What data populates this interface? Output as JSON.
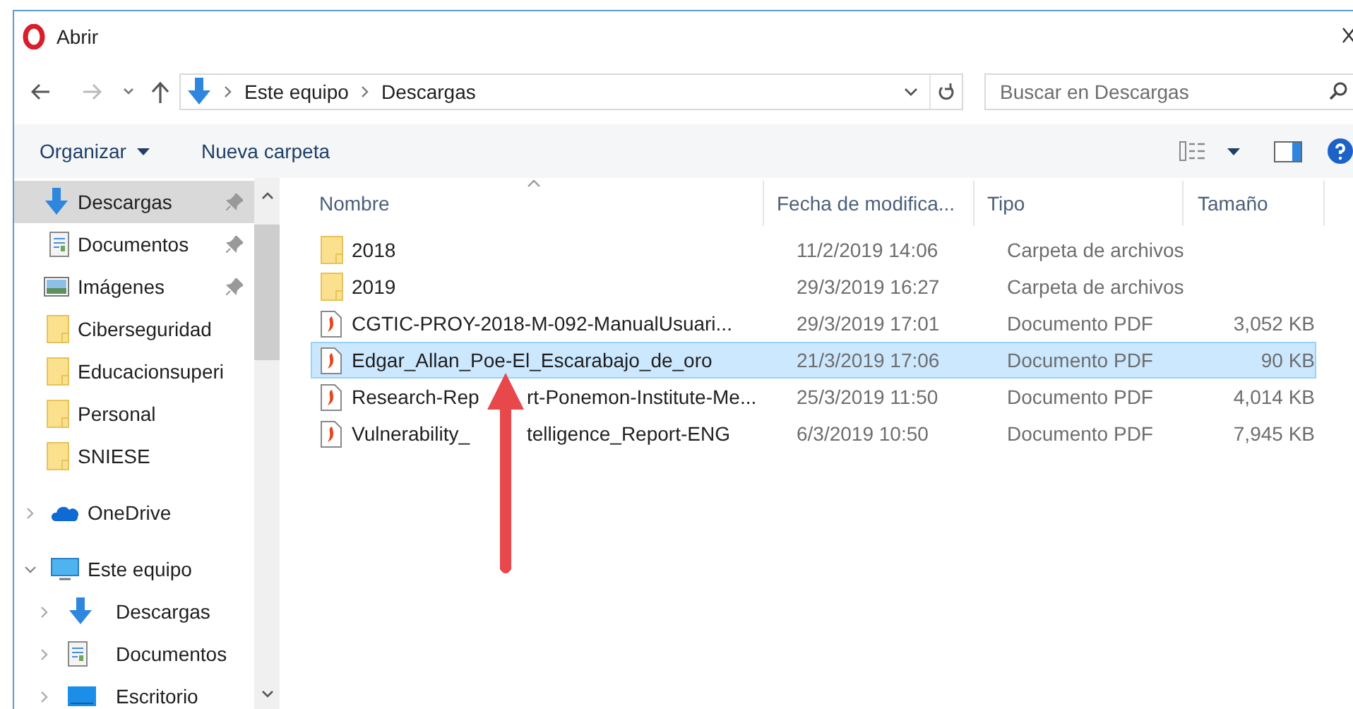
{
  "window": {
    "title": "Abrir"
  },
  "address_bar": {
    "path": [
      "Este equipo",
      "Descargas"
    ]
  },
  "search": {
    "placeholder": "Buscar en Descargas"
  },
  "toolbar": {
    "buttons": [
      {
        "label": "Organizar",
        "dropdown": true
      },
      {
        "label": "Nueva carpeta",
        "dropdown": false
      }
    ]
  },
  "sidebar": {
    "items": [
      {
        "label": "Descargas",
        "kind": "download",
        "pinned": true,
        "selected": true
      },
      {
        "label": "Documentos",
        "kind": "document",
        "pinned": true,
        "selected": false
      },
      {
        "label": "Imágenes",
        "kind": "image",
        "pinned": true,
        "selected": false
      },
      {
        "label": "Ciberseguridad",
        "kind": "folder",
        "pinned": false,
        "selected": false
      },
      {
        "label": "Educacionsuperi",
        "kind": "folder",
        "pinned": false,
        "selected": false
      },
      {
        "label": "Personal",
        "kind": "folder",
        "pinned": false,
        "selected": false
      },
      {
        "label": "SNIESE",
        "kind": "folder",
        "pinned": false,
        "selected": false
      }
    ],
    "tree": [
      {
        "label": "OneDrive",
        "kind": "cloud",
        "expanded": false
      },
      {
        "label": "Este equipo",
        "kind": "computer",
        "expanded": true,
        "children": [
          {
            "label": "Descargas",
            "kind": "download",
            "expanded": false
          },
          {
            "label": "Documentos",
            "kind": "document",
            "expanded": false
          },
          {
            "label": "Escritorio",
            "kind": "desktop",
            "expanded": false
          }
        ]
      }
    ]
  },
  "table": {
    "columns": [
      "Nombre",
      "Fecha de modifica...",
      "Tipo",
      "Tamaño"
    ],
    "rows": [
      {
        "kind": "folder",
        "name": "2018",
        "date": "11/2/2019 14:06",
        "type": "Carpeta de archivos",
        "size": null,
        "selected": false
      },
      {
        "kind": "folder",
        "name": "2019",
        "date": "29/3/2019 16:27",
        "type": "Carpeta de archivos",
        "size": null,
        "selected": false
      },
      {
        "kind": "pdf",
        "name": "CGTIC-PROY-2018-M-092-ManualUsuari...",
        "date": "29/3/2019 17:01",
        "type": "Documento PDF",
        "size": "3,052 KB",
        "selected": false
      },
      {
        "kind": "pdf",
        "name": "Edgar_Allan_Poe-El_Escarabajo_de_oro",
        "date": "21/3/2019 17:06",
        "type": "Documento PDF",
        "size": "90 KB",
        "selected": true
      },
      {
        "kind": "pdf",
        "name_parts": [
          "Research-Rep",
          "rt-Ponemon-Institute-Me..."
        ],
        "date": "25/3/2019 11:50",
        "type": "Documento PDF",
        "size": "4,014 KB",
        "selected": false
      },
      {
        "kind": "pdf",
        "name_parts": [
          "Vulnerability_",
          "telligence_Report-ENG"
        ],
        "date": "6/3/2019 10:50",
        "type": "Documento PDF",
        "size": "7,945 KB",
        "selected": false
      }
    ]
  },
  "annotation": {
    "kind": "arrow"
  }
}
